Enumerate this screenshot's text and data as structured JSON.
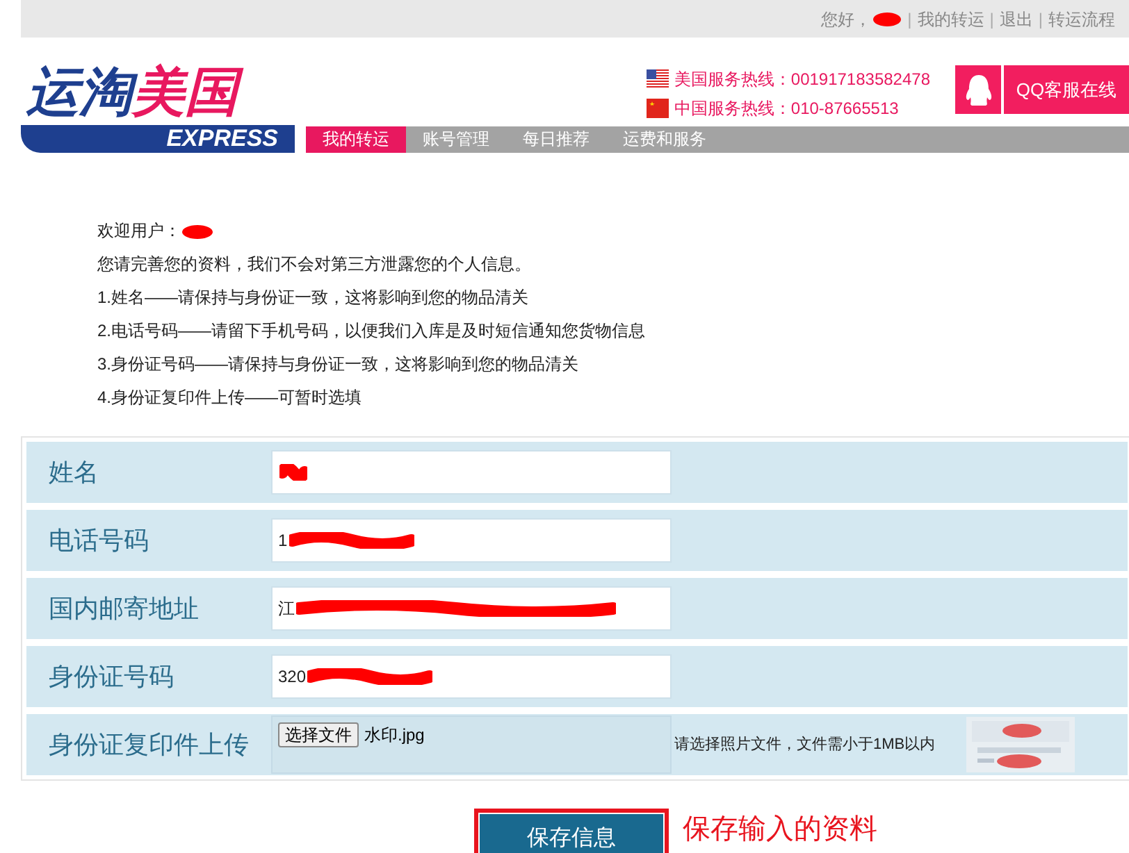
{
  "top_bar": {
    "greeting": "您好，",
    "separator": "|",
    "links": [
      "我的转运",
      "退出",
      "转运流程"
    ]
  },
  "logo": {
    "title": "运淘美国",
    "subtitle": "EXPRESS"
  },
  "hotlines": [
    {
      "kind": "us",
      "text": "美国服务热线：001917183582478"
    },
    {
      "kind": "cn",
      "text": "中国服务热线：010-87665513"
    }
  ],
  "qq_button": "QQ客服在线",
  "nav": [
    {
      "label": "我的转运",
      "selected": true
    },
    {
      "label": "账号管理",
      "selected": false
    },
    {
      "label": "每日推荐",
      "selected": false
    },
    {
      "label": "运费和服务",
      "selected": false
    }
  ],
  "intro": {
    "welcome": "欢迎用户：",
    "lines": [
      "您请完善您的资料，我们不会对第三方泄露您的个人信息。",
      "1.姓名——请保持与身份证一致，这将影响到您的物品清关",
      "2.电话号码——请留下手机号码，以便我们入库是及时短信通知您货物信息",
      "3.身份证号码——请保持与身份证一致，这将影响到您的物品清关",
      "4.身份证复印件上传——可暂时选填"
    ]
  },
  "form": [
    {
      "kind": "text",
      "label": "姓名",
      "redacted": true
    },
    {
      "kind": "text",
      "label": "电话号码",
      "value": "1",
      "redacted": true
    },
    {
      "kind": "text",
      "label": "国内邮寄地址",
      "value": "江",
      "redacted": true
    },
    {
      "kind": "text",
      "label": "身份证号码",
      "value": "320",
      "redacted": true
    },
    {
      "kind": "file",
      "label": "身份证复印件上传",
      "button": "选择文件",
      "file_name": "水印.jpg",
      "hint": "请选择照片文件，文件需小于1MB以内"
    }
  ],
  "save_button": "保存信息",
  "annotation": "保存输入的资料"
}
